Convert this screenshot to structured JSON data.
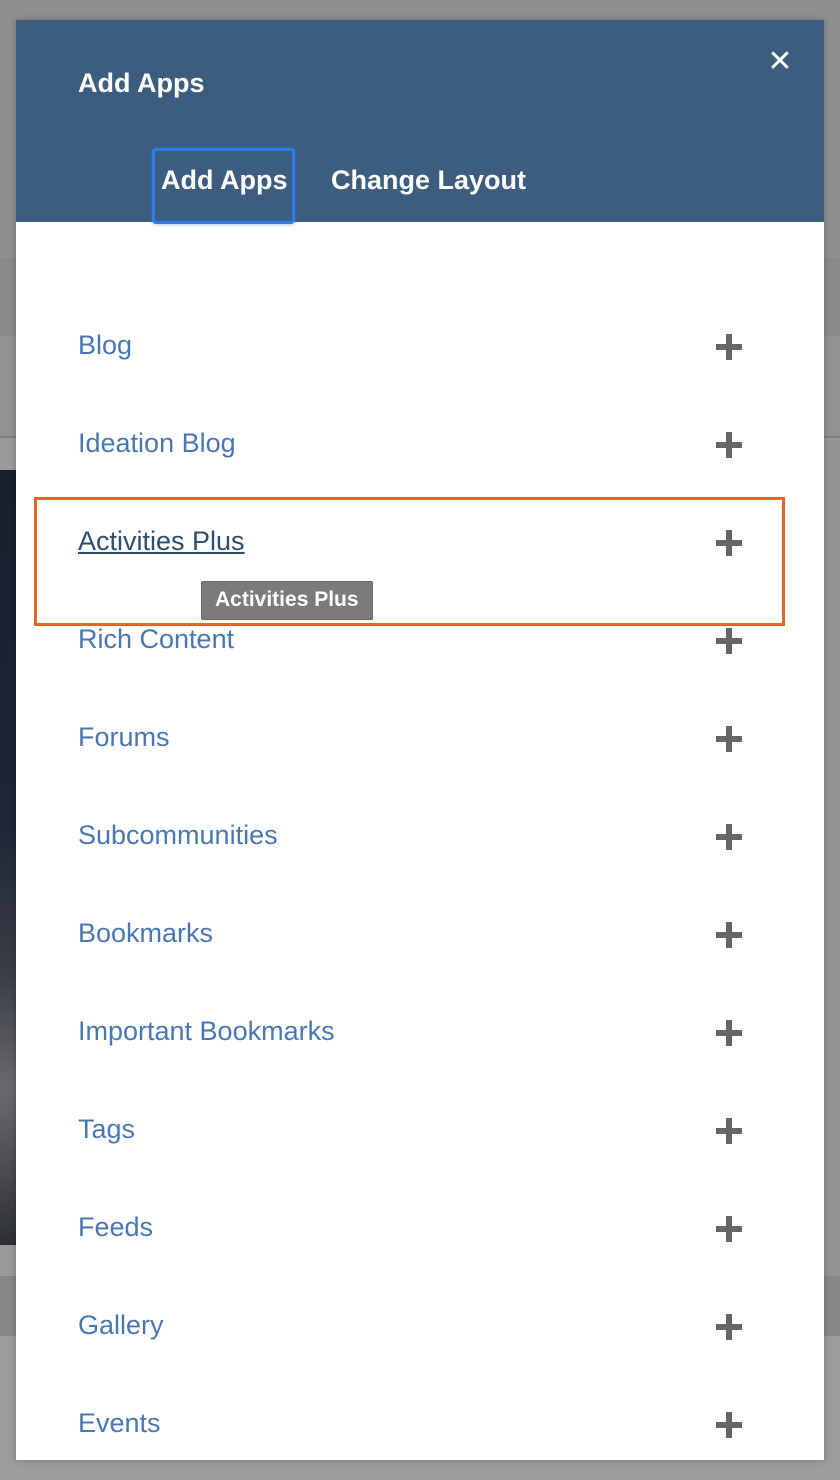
{
  "modal": {
    "title": "Add Apps",
    "close_icon": "close-icon",
    "close_glyph": "✕"
  },
  "tabs": [
    {
      "label": "Add Apps",
      "active": true
    },
    {
      "label": "Change Layout",
      "active": false
    }
  ],
  "apps": [
    {
      "label": "Blog",
      "icon": "plus-icon"
    },
    {
      "label": "Ideation Blog",
      "icon": "plus-icon"
    },
    {
      "label": "Activities Plus",
      "icon": "plus-icon",
      "hovered": true
    },
    {
      "label": "Rich Content",
      "icon": "plus-icon"
    },
    {
      "label": "Forums",
      "icon": "plus-icon"
    },
    {
      "label": "Subcommunities",
      "icon": "plus-icon"
    },
    {
      "label": "Bookmarks",
      "icon": "plus-icon"
    },
    {
      "label": "Important Bookmarks",
      "icon": "plus-icon"
    },
    {
      "label": "Tags",
      "icon": "plus-icon"
    },
    {
      "label": "Feeds",
      "icon": "plus-icon"
    },
    {
      "label": "Gallery",
      "icon": "plus-icon"
    },
    {
      "label": "Events",
      "icon": "plus-icon"
    }
  ],
  "tooltip": {
    "text": "Activities Plus"
  },
  "colors": {
    "header_bg": "#3c5d7e",
    "link": "#4a77b4",
    "link_hover": "#2f4d6f",
    "focus_ring": "#2f7ce8",
    "highlight": "#e0662a",
    "plus_icon": "#666666"
  }
}
